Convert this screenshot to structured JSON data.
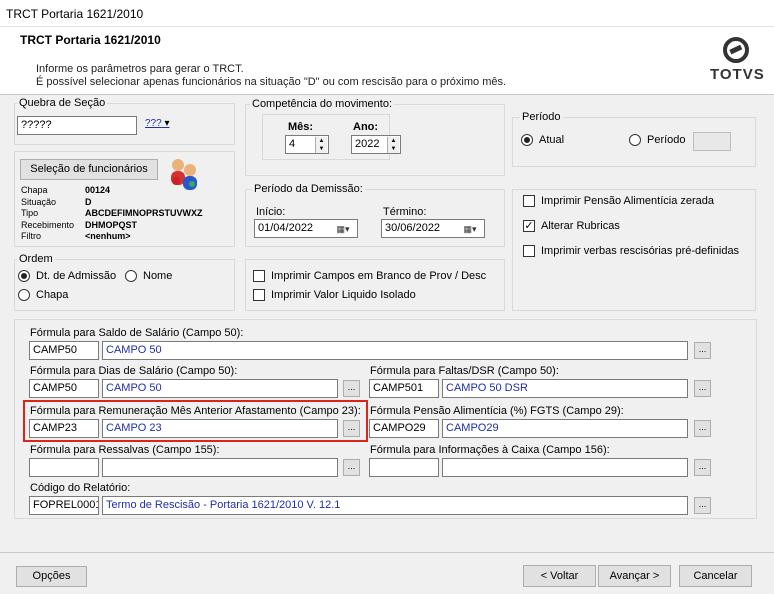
{
  "window": {
    "title": "TRCT Portaria 1621/2010"
  },
  "header": {
    "title": "TRCT Portaria 1621/2010",
    "line1": "Informe os parâmetros para gerar o TRCT.",
    "line2": "É possível selecionar apenas funcionários na situação \"D\" ou com rescisão para o próximo mês.",
    "logo_text": "TOTVS"
  },
  "quebra": {
    "label": "Quebra de Seção",
    "value": "?????",
    "dropdown_label": "???"
  },
  "selecao": {
    "button_label": "Seleção de funcionários",
    "fields": [
      {
        "label": "Chapa",
        "value": "00124"
      },
      {
        "label": "Situação",
        "value": "D"
      },
      {
        "label": "Tipo",
        "value": "ABCDEFIMNOPRSTUVWXZ"
      },
      {
        "label": "Recebimento",
        "value": "DHMOPQST"
      },
      {
        "label": "Filtro",
        "value": "<nenhum>"
      }
    ]
  },
  "ordem": {
    "label": "Ordem",
    "opt1": "Dt. de Admissão",
    "opt2": "Nome",
    "opt3": "Chapa"
  },
  "competencia": {
    "label": "Competência do movimento:",
    "mes_label": "Mês:",
    "mes_value": "4",
    "ano_label": "Ano:",
    "ano_value": "2022"
  },
  "periodo": {
    "label": "Período",
    "opt_atual": "Atual",
    "opt_periodo": "Período"
  },
  "demissao": {
    "label": "Período da Demissão:",
    "inicio_label": "Início:",
    "inicio_value": "01/04/2022",
    "termino_label": "Término:",
    "termino_value": "30/06/2022"
  },
  "opcoes_dir": {
    "pensao_zerada": "Imprimir Pensão Alimentícia zerada",
    "alterar_rubricas": "Alterar Rubricas",
    "verbas": "Imprimir verbas rescisórias pré-definidas"
  },
  "imprimir": {
    "campos_branco": "Imprimir Campos em Branco de Prov / Desc",
    "valor_liquido": "Imprimir Valor Liquido Isolado"
  },
  "formulas": {
    "saldo": {
      "label": "Fórmula para Saldo de Salário (Campo 50):",
      "code": "CAMP50",
      "desc": "CAMPO 50"
    },
    "dias": {
      "label": "Fórmula para Dias de Salário (Campo 50):",
      "code": "CAMP50",
      "desc": "CAMPO 50"
    },
    "faltas": {
      "label": "Fórmula para Faltas/DSR (Campo 50):",
      "code": "CAMP501",
      "desc": "CAMPO 50 DSR"
    },
    "remuneracao": {
      "label": "Fórmula para Remuneração Mês Anterior Afastamento (Campo 23):",
      "code": "CAMP23",
      "desc": "CAMPO 23"
    },
    "pensao": {
      "label": "Fórmula Pensão Alimentícia (%) FGTS (Campo 29):",
      "code": "CAMPO29",
      "desc": "CAMPO29"
    },
    "ressalvas": {
      "label": "Fórmula para Ressalvas (Campo 155):",
      "code": "",
      "desc": ""
    },
    "informacoes": {
      "label": "Fórmula para Informações à Caixa (Campo 156):",
      "code": "",
      "desc": ""
    },
    "relatorio": {
      "label": "Código do Relatório:",
      "code": "FOPREL0001",
      "desc": "Termo de Rescisão - Portaria 1621/2010 V. 12.1"
    },
    "browse_label": "..."
  },
  "footer": {
    "opcoes": "Opções",
    "voltar": "< Voltar",
    "avancar": "Avançar >",
    "cancelar": "Cancelar"
  },
  "colors": {
    "highlight": "#d9261c",
    "value_blue": "#1e2fa8"
  }
}
